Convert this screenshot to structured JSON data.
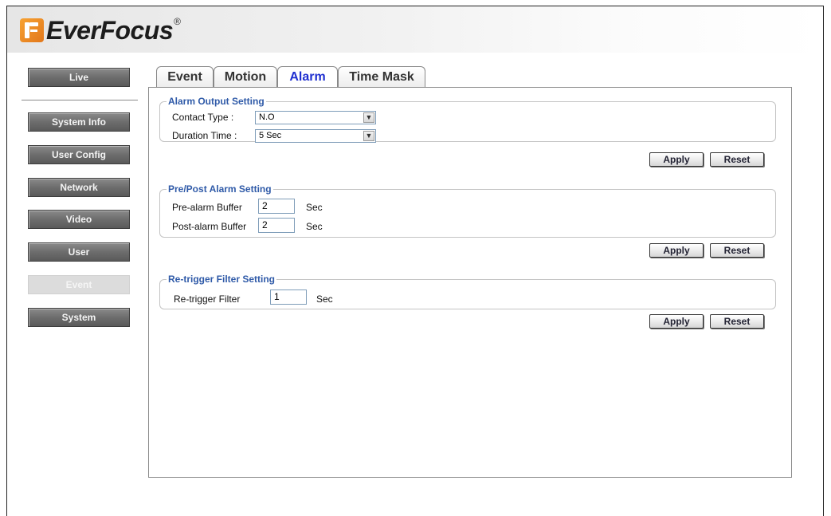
{
  "brand": {
    "name": "EverFocus",
    "trademark": "®",
    "logo_icon": "everfocus-logo-icon"
  },
  "sidebar": {
    "items": [
      {
        "label": "Live"
      },
      {
        "label": "System Info"
      },
      {
        "label": "User Config"
      },
      {
        "label": "Network"
      },
      {
        "label": "Video"
      },
      {
        "label": "User"
      },
      {
        "label": "Event",
        "active": true
      },
      {
        "label": "System"
      }
    ]
  },
  "tabs": [
    {
      "label": "Event"
    },
    {
      "label": "Motion"
    },
    {
      "label": "Alarm",
      "active": true
    },
    {
      "label": "Time Mask"
    }
  ],
  "alarm_output": {
    "title": "Alarm Output Setting",
    "contact_type_label": "Contact Type :",
    "contact_type_value": "N.O",
    "duration_label": "Duration Time :",
    "duration_value": "5 Sec",
    "apply": "Apply",
    "reset": "Reset"
  },
  "pre_post": {
    "title": "Pre/Post Alarm Setting",
    "pre_label": "Pre-alarm Buffer",
    "pre_value": "2",
    "post_label": "Post-alarm Buffer",
    "post_value": "2",
    "unit": "Sec",
    "apply": "Apply",
    "reset": "Reset"
  },
  "retrigger": {
    "title": "Re-trigger Filter Setting",
    "filter_label": "Re-trigger Filter",
    "filter_value": "1",
    "unit": "Sec",
    "apply": "Apply",
    "reset": "Reset"
  },
  "colors": {
    "accent_tab": "#1f2fd0",
    "legend": "#2f5aa8",
    "logo_orange": "#f08a24"
  }
}
